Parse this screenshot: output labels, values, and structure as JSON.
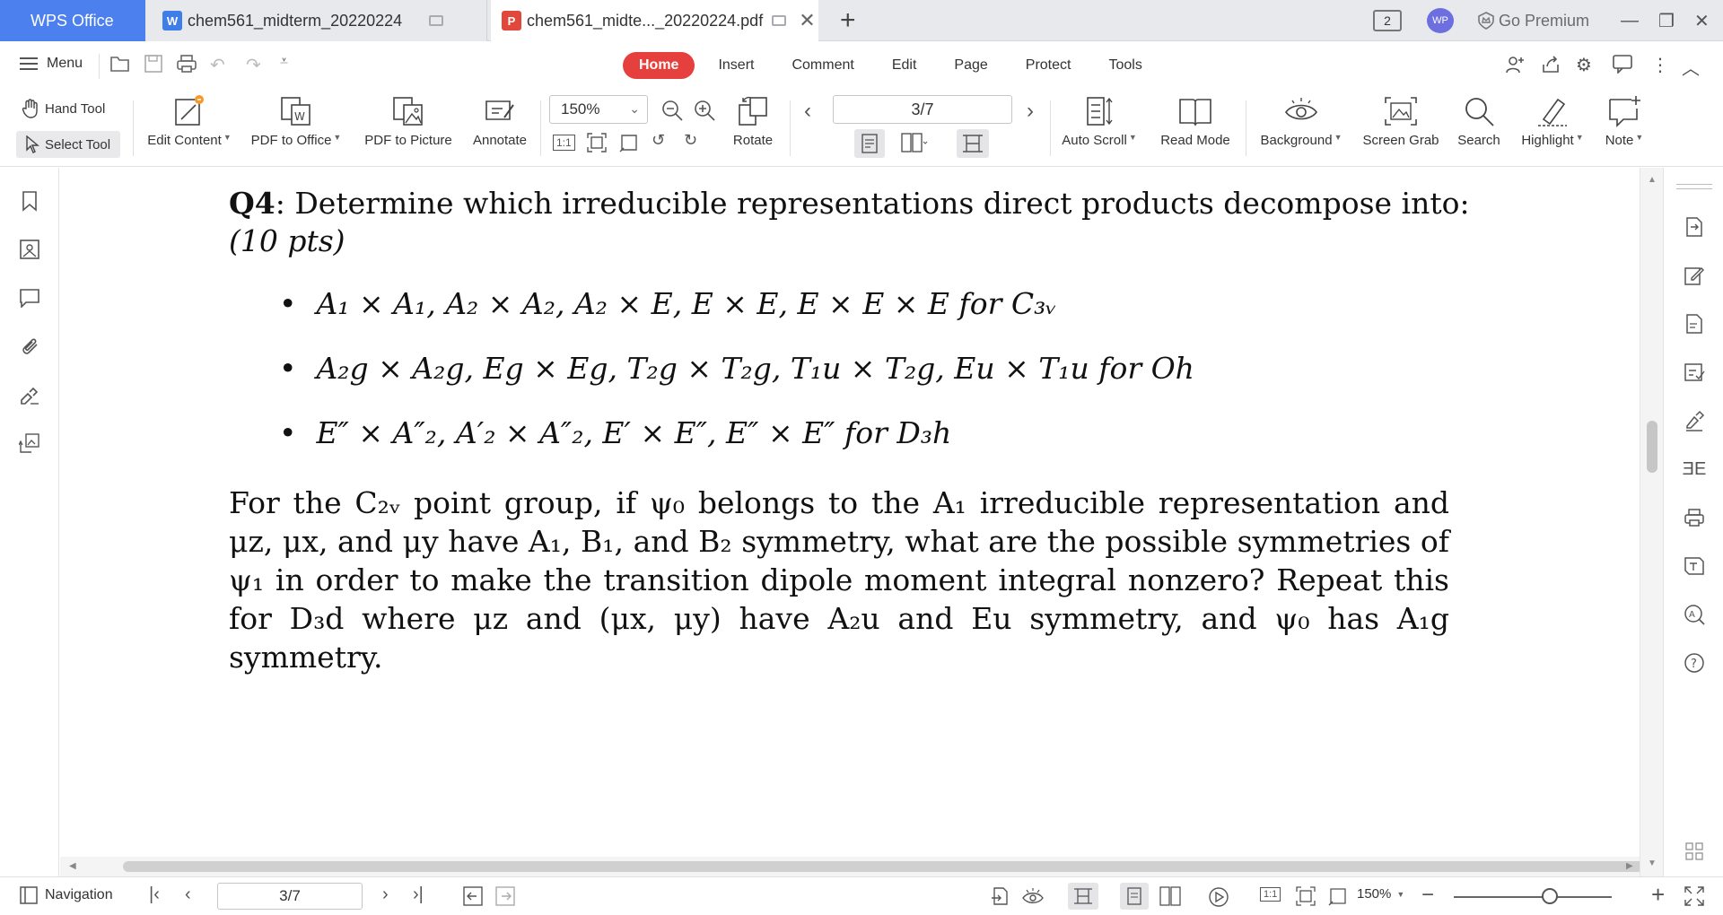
{
  "titlebar": {
    "brand": "WPS Office",
    "tabs": [
      {
        "title": "chem561_midterm_20220224",
        "icon": "W"
      },
      {
        "title": "chem561_midte..._20220224.pdf",
        "icon": "P"
      }
    ],
    "page_badge": "2",
    "avatar": "WP",
    "premium": "Go Premium"
  },
  "menu": {
    "label": "Menu",
    "tabs": [
      "Home",
      "Insert",
      "Comment",
      "Edit",
      "Page",
      "Protect",
      "Tools"
    ]
  },
  "toolbar": {
    "hand_tool": "Hand Tool",
    "select_tool": "Select Tool",
    "edit_content": "Edit Content",
    "pdf_to_office": "PDF to Office",
    "pdf_to_picture": "PDF to Picture",
    "annotate": "Annotate",
    "zoom": "150%",
    "rotate": "Rotate",
    "page": "3/7",
    "auto_scroll": "Auto Scroll",
    "read_mode": "Read Mode",
    "background": "Background",
    "screen_grab": "Screen Grab",
    "search": "Search",
    "highlight": "Highlight",
    "note": "Note",
    "fit_label": "1:1"
  },
  "document": {
    "q_label": "Q4",
    "q_text": ": Determine which irreducible representations direct products decompose into:",
    "q_points": "(10 pts)",
    "bullets": [
      "A₁ × A₁, A₂ × A₂, A₂ × E, E × E, E × E × E for C₃ᵥ",
      "A₂g × A₂g, Eg × Eg, T₂g × T₂g, T₁u × T₂g, Eu × T₁u for Oh",
      "E″ × A″₂, A′₂ × A″₂, E′ × E″, E″ × E″ for D₃h"
    ],
    "paragraph": "For the C₂ᵥ point group, if ψ₀ belongs to the A₁ irreducible representation and μz, μx, and μy have A₁, B₁, and B₂ symmetry, what are the possible symmetries of ψ₁ in order to make the transition dipole moment integral nonzero? Repeat this for D₃d where μz and (μx, μy) have A₂u and Eu symmetry, and ψ₀ has A₁g symmetry."
  },
  "statusbar": {
    "navigation": "Navigation",
    "page": "3/7",
    "zoom": "150%",
    "fit_label": "1:1"
  },
  "colors": {
    "brand": "#4b80ee",
    "home_tab": "#e5403d"
  }
}
